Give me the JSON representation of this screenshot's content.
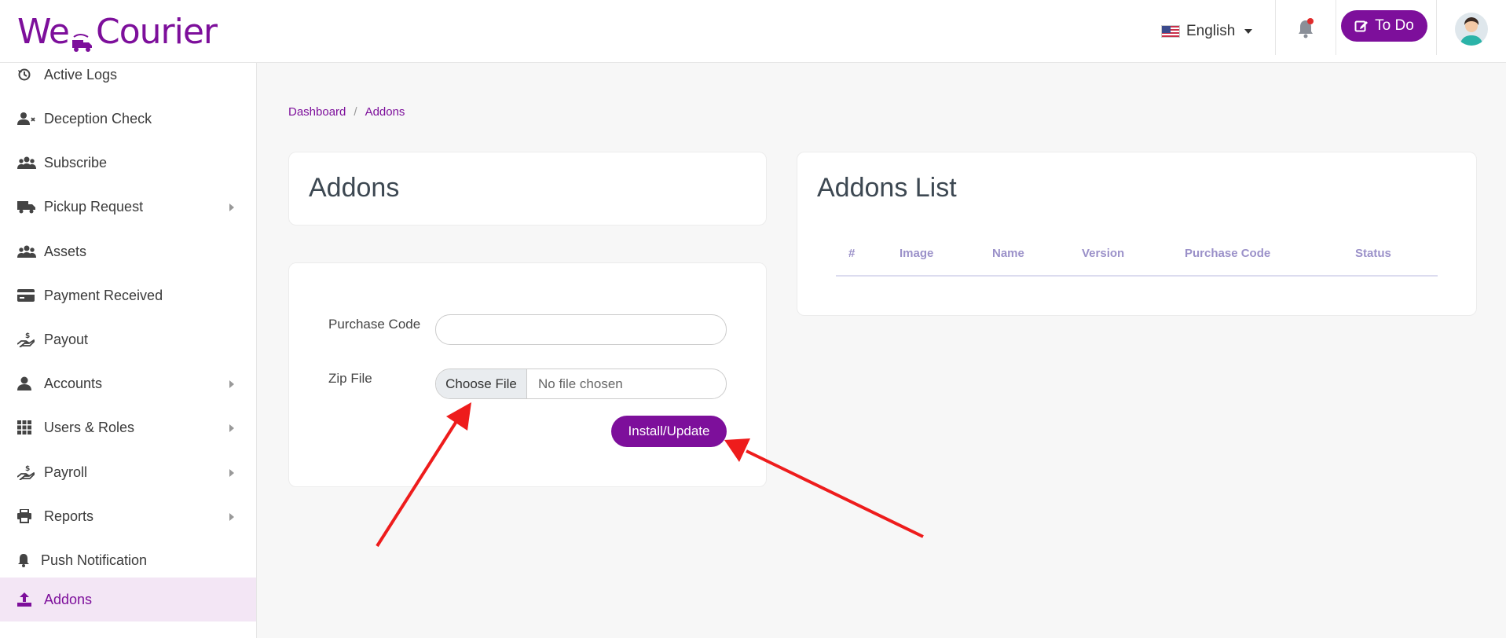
{
  "app": {
    "name": "WeCourier",
    "logo_left": "We",
    "logo_right": "Courier"
  },
  "header": {
    "language": "English",
    "todo_label": "To Do",
    "colors": {
      "brand": "#7d0f9b",
      "notification_dot": "#e02b2b"
    }
  },
  "sidebar": {
    "items": [
      {
        "label": "Active Logs",
        "icon": "history-icon",
        "has_submenu": false
      },
      {
        "label": "Deception Check",
        "icon": "user-x-icon",
        "has_submenu": false
      },
      {
        "label": "Subscribe",
        "icon": "users-icon",
        "has_submenu": false
      },
      {
        "label": "Pickup Request",
        "icon": "truck-icon",
        "has_submenu": true
      },
      {
        "label": "Assets",
        "icon": "users-icon",
        "has_submenu": false
      },
      {
        "label": "Payment Received",
        "icon": "credit-card-icon",
        "has_submenu": false
      },
      {
        "label": "Payout",
        "icon": "hand-dollar-icon",
        "has_submenu": false
      },
      {
        "label": "Accounts",
        "icon": "user-icon",
        "has_submenu": true
      },
      {
        "label": "Users & Roles",
        "icon": "grid-icon",
        "has_submenu": true
      },
      {
        "label": "Payroll",
        "icon": "hand-dollar-icon",
        "has_submenu": true
      },
      {
        "label": "Reports",
        "icon": "printer-icon",
        "has_submenu": true
      },
      {
        "label": "Push Notification",
        "icon": "bell-icon",
        "has_submenu": false
      },
      {
        "label": "Addons",
        "icon": "upload-icon",
        "has_submenu": false,
        "active": true
      }
    ]
  },
  "breadcrumb": {
    "items": [
      "Dashboard",
      "Addons"
    ],
    "separator": "/"
  },
  "addons_card": {
    "title": "Addons"
  },
  "form": {
    "purchase_code_label": "Purchase Code",
    "purchase_code_value": "",
    "zip_file_label": "Zip File",
    "choose_file_label": "Choose File",
    "no_file_label": "No file chosen",
    "submit_label": "Install/Update"
  },
  "addons_list": {
    "title": "Addons List",
    "columns": [
      "#",
      "Image",
      "Name",
      "Version",
      "Purchase Code",
      "Status"
    ],
    "rows": []
  },
  "annotations": {
    "arrow_color": "#ee1c1c"
  }
}
